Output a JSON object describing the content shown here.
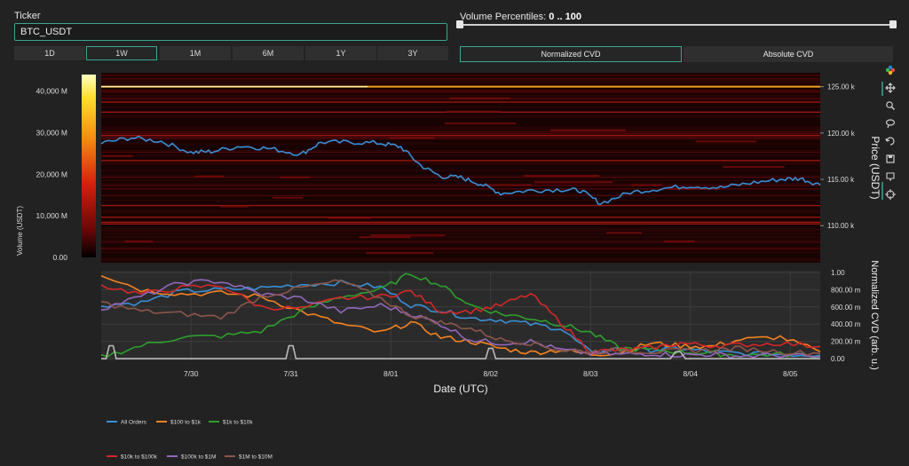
{
  "ticker": {
    "label": "Ticker",
    "value": "BTC_USDT"
  },
  "volume_percentiles": {
    "label": "Volume Percentiles:",
    "value": "0 .. 100"
  },
  "time_ranges": [
    {
      "label": "1D",
      "active": false
    },
    {
      "label": "1W",
      "active": true
    },
    {
      "label": "1M",
      "active": false
    },
    {
      "label": "6M",
      "active": false
    },
    {
      "label": "1Y",
      "active": false
    },
    {
      "label": "3Y",
      "active": false
    }
  ],
  "cvd_modes": [
    {
      "label": "Normalized CVD",
      "active": true
    },
    {
      "label": "Absolute CVD",
      "active": false
    }
  ],
  "toolbar": [
    "plotly-logo-icon",
    "pan-icon",
    "zoom-icon",
    "lasso-icon",
    "reset-axes-icon",
    "save-icon",
    "hover-icon",
    "spike-icon"
  ],
  "chart_data": [
    {
      "type": "heatmap",
      "ylabel": "Price (USDT)",
      "colorbar": {
        "title": "Volume (USDT)",
        "ticks": [
          "40,000 M",
          "30,000 M",
          "20,000 M",
          "10,000 M",
          "0.00"
        ],
        "values": [
          40000,
          30000,
          20000,
          10000,
          0
        ],
        "range": [
          0,
          44000
        ]
      },
      "ylim": [
        106000,
        126500
      ],
      "yticks": [
        "125.00 k",
        "120.00 k",
        "115.00 k",
        "110.00 k"
      ],
      "ytick_values": [
        125000,
        120000,
        115000,
        110000
      ],
      "x_range": [
        0,
        7.2
      ],
      "price_series": {
        "name": "Price",
        "color": "#3a8fd6",
        "x": [
          0,
          0.3,
          0.6,
          0.9,
          1.1,
          1.4,
          1.7,
          2.0,
          2.2,
          2.5,
          2.8,
          3.0,
          3.2,
          3.4,
          3.6,
          3.8,
          4.0,
          4.3,
          4.6,
          4.8,
          5.0,
          5.3,
          5.6,
          5.9,
          6.2,
          6.5,
          6.8,
          7.0,
          7.2
        ],
        "y": [
          118900,
          119500,
          119100,
          117900,
          118000,
          118600,
          118300,
          117700,
          119000,
          119000,
          118900,
          118500,
          116500,
          115300,
          115200,
          114500,
          113500,
          113800,
          113900,
          113800,
          112400,
          113600,
          114000,
          114300,
          114100,
          114600,
          115000,
          115100,
          114400
        ]
      },
      "highlight_line": {
        "price": 125000,
        "color": "#f2a21b"
      }
    },
    {
      "type": "line",
      "xlabel": "Date (UTC)",
      "ylabel": "Normalized CVD (arb. u.)",
      "ylim": [
        -0.02,
        1.02
      ],
      "yticks": [
        "1.00",
        "800.00 m",
        "600.00 m",
        "400.00 m",
        "200.00 m",
        "0.00"
      ],
      "ytick_values": [
        1.0,
        0.8,
        0.6,
        0.4,
        0.2,
        0.0
      ],
      "x_range": [
        0,
        7.2
      ],
      "xticks": [
        "7/30",
        "7/31",
        "8/01",
        "8/02",
        "8/03",
        "8/04",
        "8/05"
      ],
      "xtick_values": [
        0.9,
        1.9,
        2.9,
        3.9,
        4.9,
        5.9,
        6.9
      ],
      "series": [
        {
          "name": "All Orders",
          "color": "#3a8fd6",
          "x": [
            0,
            0.4,
            0.8,
            1.2,
            1.6,
            2.0,
            2.4,
            2.8,
            3.1,
            3.4,
            3.7,
            4.0,
            4.3,
            4.6,
            4.9,
            5.2,
            5.5,
            5.8,
            6.1,
            6.4,
            6.8,
            7.2
          ],
          "y": [
            0.62,
            0.65,
            0.78,
            0.8,
            0.82,
            0.86,
            0.88,
            0.83,
            0.62,
            0.56,
            0.47,
            0.45,
            0.4,
            0.35,
            0.07,
            0.12,
            0.1,
            0.12,
            0.08,
            0.06,
            0.05,
            0.04
          ]
        },
        {
          "name": "$100 to $1k",
          "color": "#f58220",
          "x": [
            0,
            0.4,
            0.8,
            1.2,
            1.6,
            2.0,
            2.4,
            2.8,
            3.1,
            3.4,
            3.7,
            4.0,
            4.3,
            4.6,
            4.9,
            5.2,
            5.5,
            5.8,
            6.1,
            6.4,
            6.8,
            7.2
          ],
          "y": [
            0.98,
            0.8,
            0.75,
            0.76,
            0.72,
            0.55,
            0.4,
            0.3,
            0.42,
            0.25,
            0.2,
            0.12,
            0.07,
            0.1,
            0.05,
            0.07,
            0.18,
            0.15,
            0.14,
            0.22,
            0.25,
            0.08
          ]
        },
        {
          "name": "$1k to $10k",
          "color": "#2ca02c",
          "x": [
            0,
            0.4,
            0.8,
            1.2,
            1.6,
            2.0,
            2.4,
            2.8,
            3.1,
            3.4,
            3.7,
            4.0,
            4.3,
            4.6,
            4.9,
            5.2,
            5.5,
            5.8,
            6.1,
            6.4,
            6.8,
            7.2
          ],
          "y": [
            0.02,
            0.15,
            0.25,
            0.26,
            0.32,
            0.55,
            0.72,
            0.8,
            0.99,
            0.85,
            0.62,
            0.52,
            0.47,
            0.4,
            0.3,
            0.12,
            0.1,
            0.08,
            0.06,
            0.04,
            0.05,
            0.03
          ]
        },
        {
          "name": "$10k to $100k",
          "color": "#d62728",
          "x": [
            0,
            0.4,
            0.8,
            1.2,
            1.6,
            2.0,
            2.4,
            2.8,
            3.1,
            3.4,
            3.7,
            4.0,
            4.3,
            4.6,
            4.9,
            5.2,
            5.5,
            5.8,
            6.1,
            6.4,
            6.8,
            7.2
          ],
          "y": [
            0.85,
            0.75,
            0.82,
            0.85,
            0.6,
            0.58,
            0.7,
            0.72,
            0.78,
            0.55,
            0.55,
            0.62,
            0.75,
            0.42,
            0.08,
            0.1,
            0.12,
            0.18,
            0.15,
            0.16,
            0.18,
            0.14
          ]
        },
        {
          "name": "$100k to $1M",
          "color": "#9467bd",
          "x": [
            0,
            0.4,
            0.8,
            1.2,
            1.6,
            2.0,
            2.4,
            2.8,
            3.1,
            3.4,
            3.7,
            4.0,
            4.3,
            4.6,
            4.9,
            5.2,
            5.5,
            5.8,
            6.1,
            6.4,
            6.8,
            7.2
          ],
          "y": [
            0.58,
            0.72,
            0.88,
            0.9,
            0.75,
            0.7,
            0.55,
            0.62,
            0.52,
            0.4,
            0.22,
            0.18,
            0.2,
            0.1,
            0.06,
            0.05,
            0.06,
            0.04,
            0.05,
            0.03,
            0.04,
            0.02
          ]
        },
        {
          "name": "$1M to $10M",
          "color": "#8c564b",
          "x": [
            0,
            0.4,
            0.8,
            1.2,
            1.6,
            2.0,
            2.4,
            2.8,
            3.1,
            3.4,
            3.7,
            4.0,
            4.3,
            4.6,
            4.9,
            5.2,
            5.5,
            5.8,
            6.1,
            6.4,
            6.8,
            7.2
          ],
          "y": [
            0.65,
            0.55,
            0.52,
            0.48,
            0.72,
            0.82,
            0.9,
            0.7,
            0.5,
            0.42,
            0.35,
            0.22,
            0.18,
            0.1,
            0.08,
            0.1,
            0.08,
            0.09,
            0.1,
            0.12,
            0.08,
            0.06
          ]
        },
        {
          "name": "",
          "color": "#bbbbbb",
          "x": [
            0,
            0.05,
            0.08,
            0.12,
            0.15,
            1.85,
            1.88,
            1.92,
            1.95,
            3.85,
            3.88,
            3.92,
            3.95,
            5.7,
            5.75,
            5.8,
            5.85,
            7.2
          ],
          "y": [
            0.0,
            0.0,
            0.15,
            0.15,
            0.0,
            0.0,
            0.15,
            0.15,
            0.0,
            0.0,
            0.12,
            0.12,
            0.0,
            0.0,
            0.08,
            0.08,
            0.0,
            0.0
          ]
        }
      ],
      "legend_position": "bottom-left"
    }
  ]
}
